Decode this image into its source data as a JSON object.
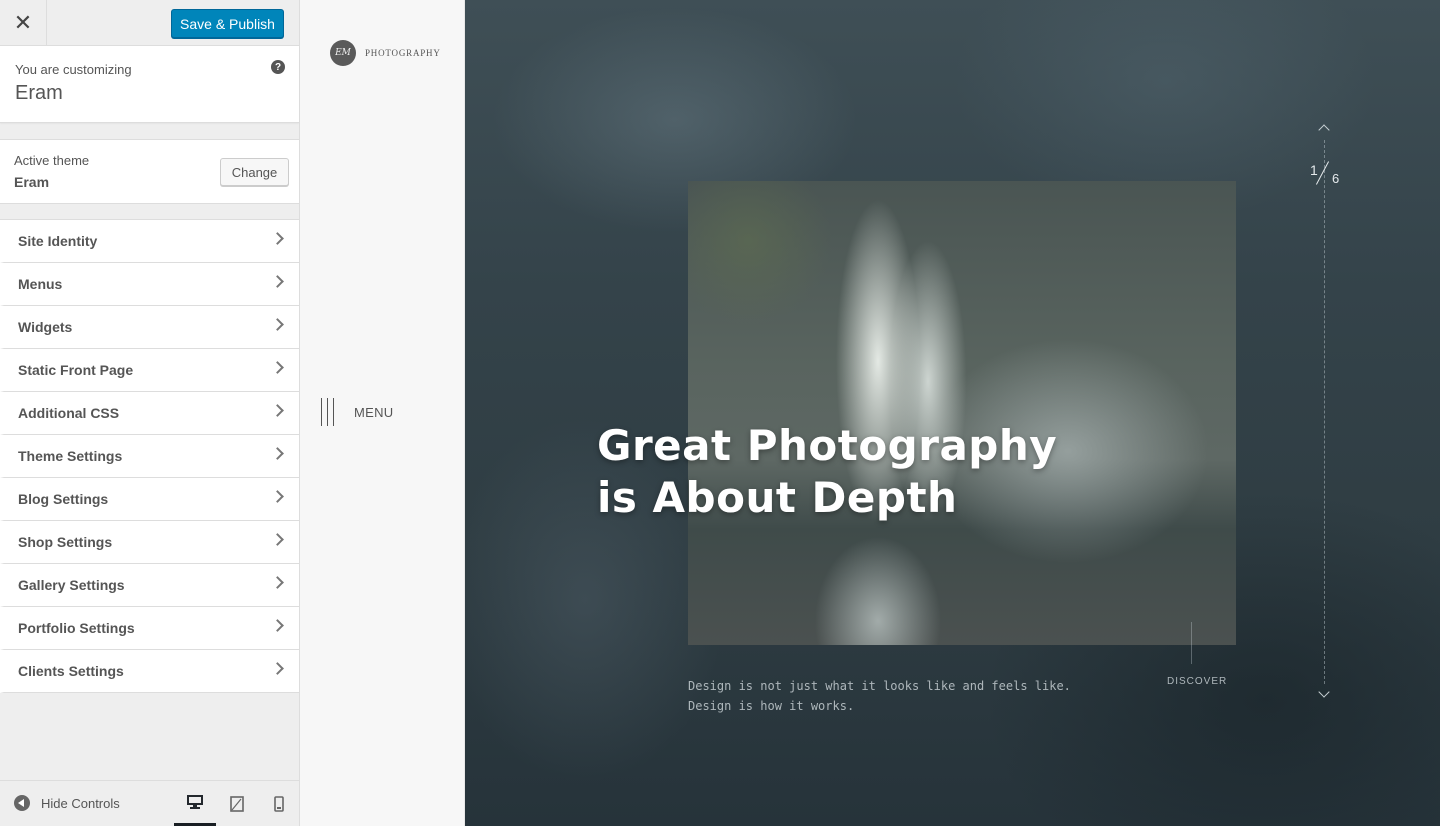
{
  "sidebar": {
    "publish_label": "Save & Publish",
    "close_glyph": "✕",
    "info": {
      "label": "You are customizing",
      "title": "Eram",
      "help_glyph": "?"
    },
    "active_theme": {
      "label": "Active theme",
      "name": "Eram",
      "change_label": "Change"
    },
    "panels": [
      "Site Identity",
      "Menus",
      "Widgets",
      "Static Front Page",
      "Additional CSS",
      "Theme Settings",
      "Blog Settings",
      "Shop Settings",
      "Gallery Settings",
      "Portfolio Settings",
      "Clients Settings"
    ],
    "footer": {
      "hide_label": "Hide Controls",
      "devices": [
        "desktop-icon",
        "tablet-icon",
        "mobile-icon"
      ],
      "active_device": "desktop"
    }
  },
  "preview": {
    "logo_mark": "EM",
    "logo_text": "PHOTOGRAPHY",
    "menu_label": "MENU",
    "hero_title_line1": "Great Photography",
    "hero_title_line2": "is About Depth",
    "hero_desc_line1": "Design is not just what it looks like and feels like.",
    "hero_desc_line2": "Design is how it works.",
    "discover_label": "DISCOVER",
    "pager_current": "1",
    "pager_total": "6"
  },
  "colors": {
    "accent": "#0085ba",
    "sidebar_bg": "#eeeeee",
    "hero_bg": "#34434a"
  }
}
